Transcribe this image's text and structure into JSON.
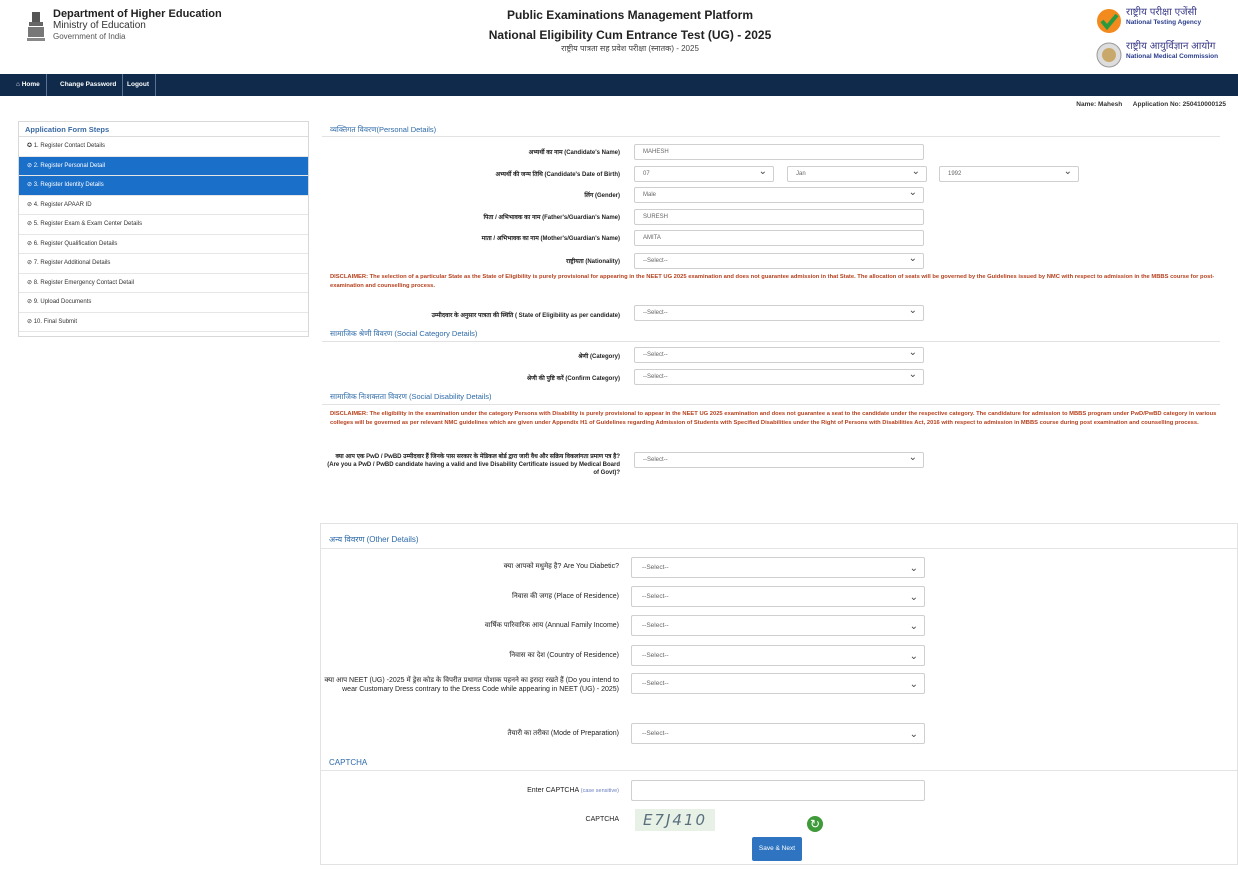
{
  "header": {
    "dept_line1": "Department of Higher Education",
    "dept_line2": "Ministry of Education",
    "dept_line3": "Government of India",
    "title1": "Public Examinations Management Platform",
    "title2": "National Eligibility Cum Entrance Test (UG) - 2025",
    "title3": "राष्ट्रीय पात्रता सह प्रवेश परीक्षा (स्नातक) - 2025",
    "nta_hi": "राष्ट्रीय परीक्षा एजेंसी",
    "nta_en": "National Testing Agency",
    "nmc_hi": "राष्ट्रीय आयुर्विज्ञान आयोग",
    "nmc_en": "National Medical Commission"
  },
  "nav": {
    "home": "⌂ Home",
    "change_password": "Change Password",
    "logout": "Logout"
  },
  "user": {
    "name_label": "Name: Mahesh",
    "app_no": "Application No: 250410000125"
  },
  "sidebar": {
    "title": "Application Form Steps",
    "steps": [
      "✪ 1. Register Contact Details",
      "⊘ 2. Register Personal Detail",
      "⊘ 3. Register Identity Details",
      "⊘ 4. Register APAAR ID",
      "⊘ 5. Register Exam & Exam Center Details",
      "⊘ 6. Register Qualification Details",
      "⊘ 7. Register Additional Details",
      "⊘ 8. Register Emergency Contact Detail",
      "⊘ 9. Upload Documents",
      "⊘ 10. Final Submit"
    ]
  },
  "personal": {
    "section_title": "व्यक्तिगत विवरण(Personal Details)",
    "name_label": "अभ्यर्थी का नाम (Candidate's Name)",
    "name_value": "MAHESH",
    "dob_label": "अभ्यर्थी की जन्म तिथि (Candidate's Date of Birth)",
    "dob_day": "07",
    "dob_month": "Jan",
    "dob_year": "1992",
    "gender_label": "लिंग (Gender)",
    "gender_value": "Male",
    "father_label": "पिता / अभिभावक का नाम (Father's/Guardian's Name)",
    "father_value": "SURESH",
    "mother_label": "माता / अभिभावक का नाम (Mother's/Guardian's Name)",
    "mother_value": "AMITA",
    "nationality_label": "राष्ट्रीयता (Nationality)",
    "nationality_value": "--Select--",
    "disclaimer1": "DISCLAIMER: The selection of a particular State as the State of Eligibility is purely provisional for appearing in the NEET UG 2025 examination and does not guarantee admission in that State. The allocation of seats will be governed by the Guidelines issued by NMC with respect to admission in the MBBS course for post-examination and counselling process.",
    "state_label": "उम्मीदवार के अनुसार पात्रता की स्थिति ( State of Eligibility as per candidate)",
    "state_value": "--Select--"
  },
  "social": {
    "section_title": "सामाजिक श्रेणी विवरण (Social Category Details)",
    "category_label": "श्रेणी (Category)",
    "category_value": "--Select--",
    "confirm_label": "श्रेणी की पुष्टि करें (Confirm Category)",
    "confirm_value": "--Select--"
  },
  "disability": {
    "section_title": "सामाजिक निःशक्तता विवरण (Social Disability Details)",
    "disclaimer": "DISCLAIMER: The eligibility in the examination under the category Persons with Disability is purely provisional to appear in the NEET UG 2025 examination and does not guarantee a seat to the candidate under the respective category. The candidature for admission to MBBS program under PwD/PwBD category in various colleges will be governed as per relevant NMC guidelines which are given under Appendix H1 of Guidelines regarding Admission of Students with Specified Disabilities under the Right of Persons with Disabilities Act, 2016 with respect to admission in MBBS course during post examination and counselling process.",
    "pwd_label": "क्या आप एक PwD / PwBD उम्मीदवार हैं जिनके पास सरकार के मेडिकल बोर्ड द्वारा जारी वैध और सक्रिय विकलांगता प्रमाण पत्र है? (Are you a PwD / PwBD candidate having a valid and live Disability Certificate issued by Medical Board of Govt)?",
    "pwd_value": "--Select--"
  },
  "other": {
    "section_title": "अन्य विवरण (Other Details)",
    "diabetic_label": "क्या आपको मधुमेह है? Are You Diabetic?",
    "diabetic_value": "--Select--",
    "residence_label": "निवास की जगह (Place of Residence)",
    "residence_value": "--Select--",
    "income_label": "वार्षिक पारिवारिक आय (Annual Family Income)",
    "income_value": "--Select--",
    "country_label": "निवास का देश (Country of Residence)",
    "country_value": "--Select--",
    "dress_label": "क्या आप NEET (UG) -2025 में ड्रेस कोड के विपरीत प्रथागत पोशाक पहनने का इरादा रखते हैं (Do you intend to wear Customary Dress contrary to the Dress Code while appearing in NEET (UG) - 2025)",
    "dress_value": "--Select--",
    "prep_label": "तैयारी का तरीका (Mode of Preparation)",
    "prep_value": "--Select--"
  },
  "captcha": {
    "section_title": "CAPTCHA",
    "enter_label": "Enter CAPTCHA",
    "enter_note": "(case sensitive)",
    "captcha_label": "CAPTCHA",
    "captcha_text": "E7J410",
    "save_button": "Save & Next"
  }
}
